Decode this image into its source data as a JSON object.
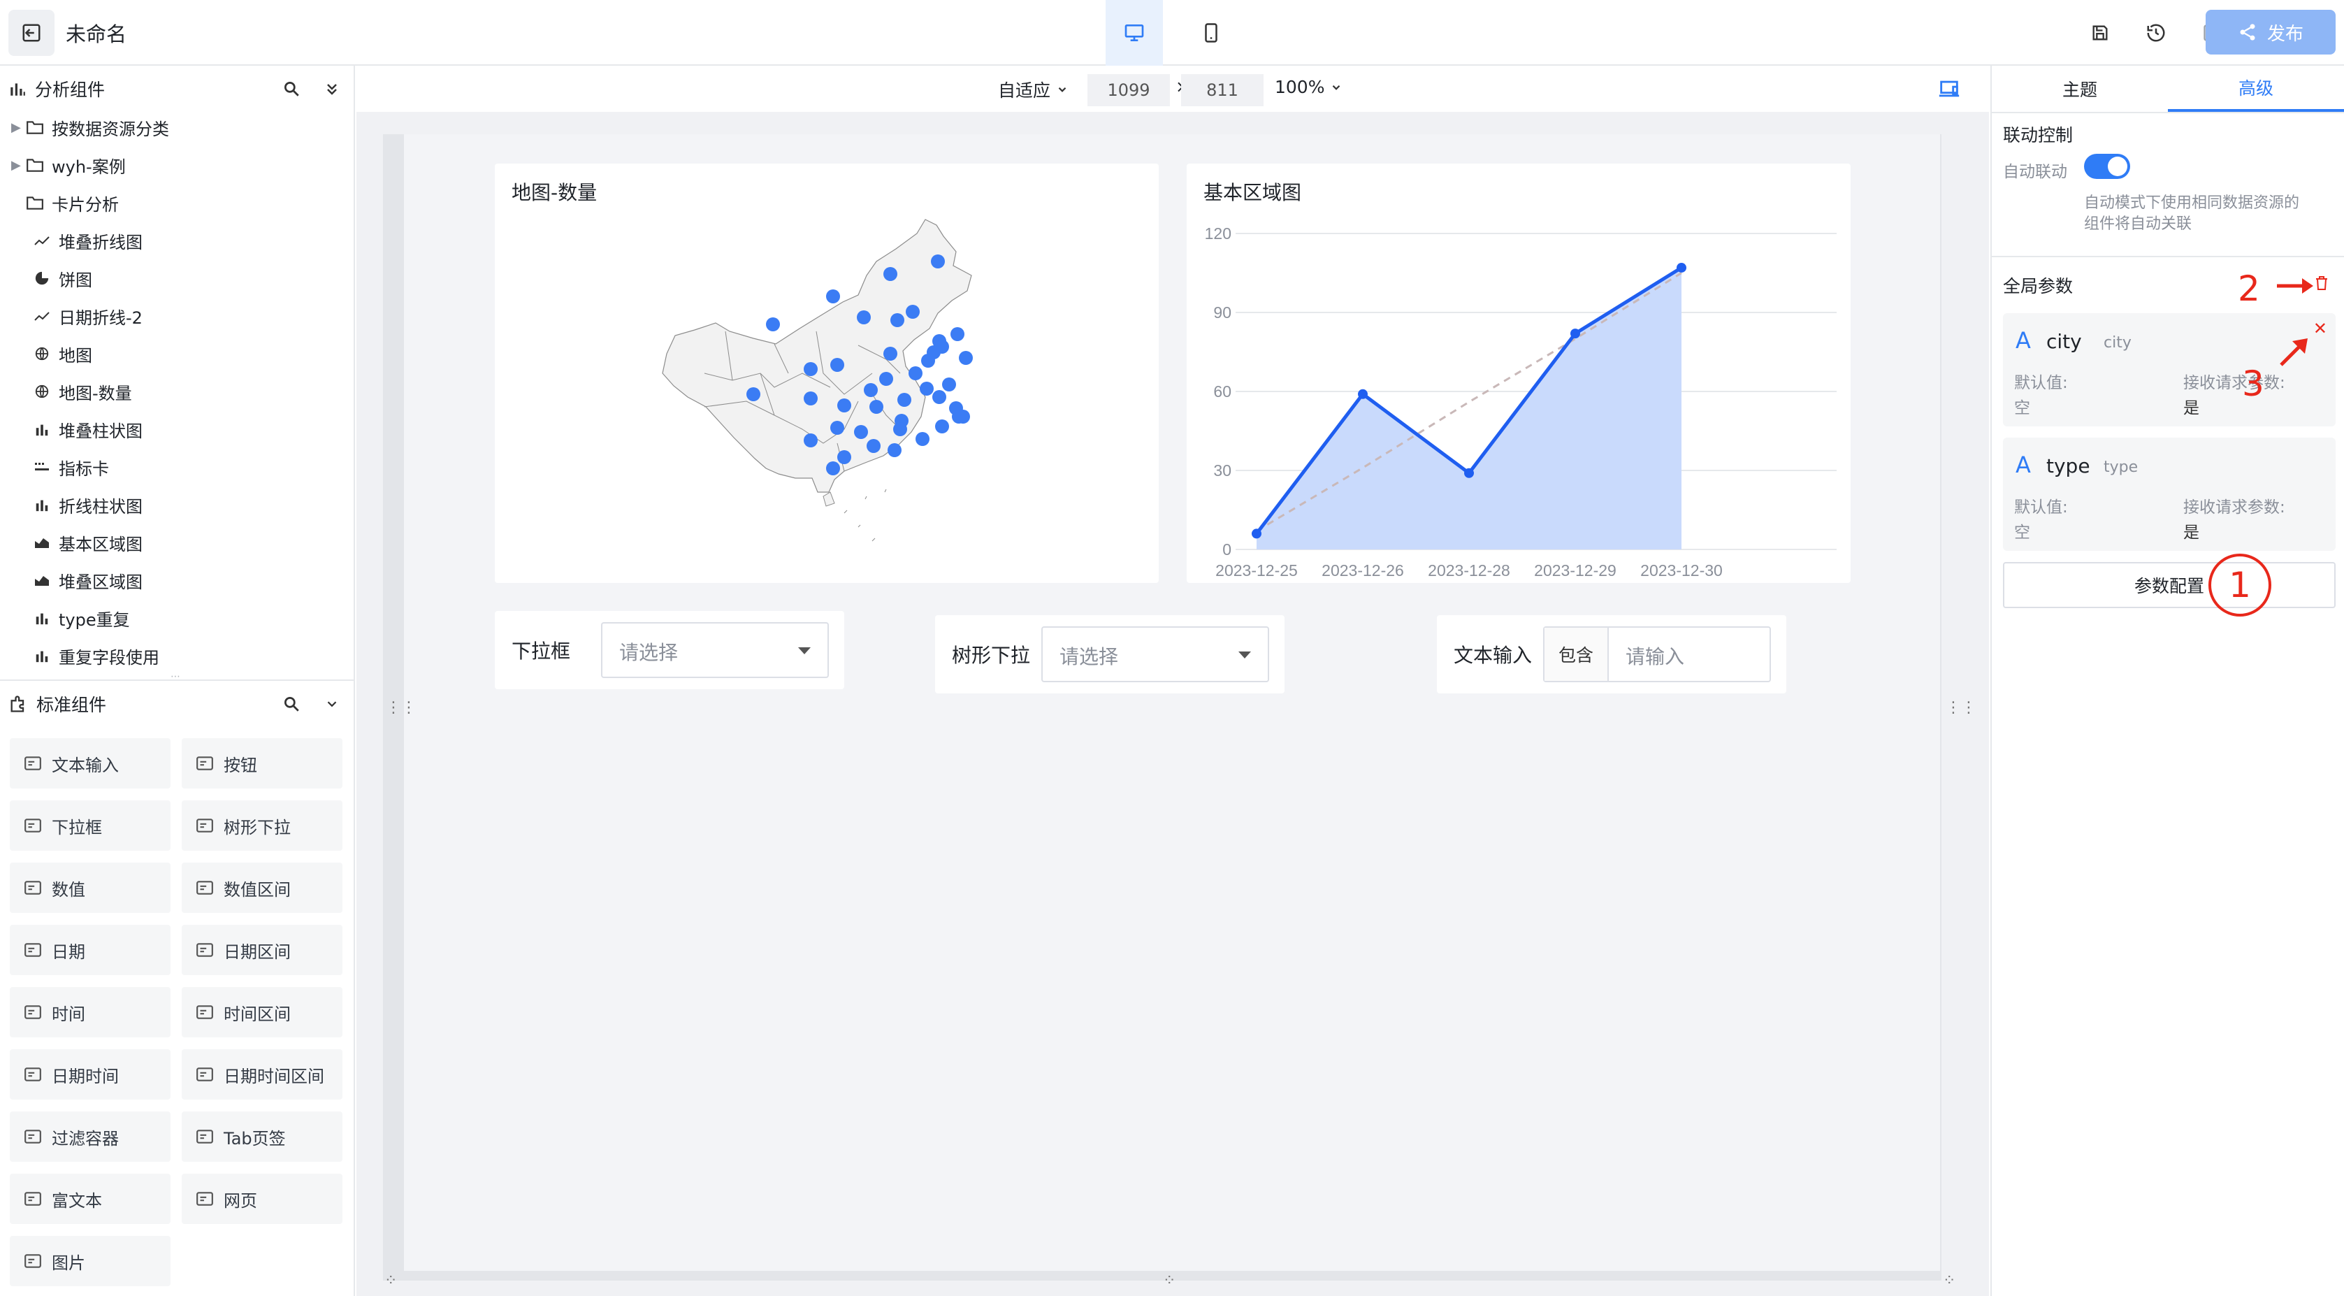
{
  "header": {
    "title": "未命名",
    "publish_label": "发布"
  },
  "left_panel": {
    "analysis_title": "分析组件",
    "tree": [
      {
        "label": "按数据资源分类",
        "type": "folder",
        "expandable": true
      },
      {
        "label": "wyh-案例",
        "type": "folder",
        "expandable": true
      },
      {
        "label": "卡片分析",
        "type": "folder",
        "expandable": false
      },
      {
        "label": "堆叠折线图",
        "type": "line-icon"
      },
      {
        "label": "饼图",
        "type": "pie-icon"
      },
      {
        "label": "日期折线-2",
        "type": "line-icon"
      },
      {
        "label": "地图",
        "type": "map-icon"
      },
      {
        "label": "地图-数量",
        "type": "map-icon"
      },
      {
        "label": "堆叠柱状图",
        "type": "bar-icon"
      },
      {
        "label": "指标卡",
        "type": "card-icon"
      },
      {
        "label": "折线柱状图",
        "type": "bar-icon"
      },
      {
        "label": "基本区域图",
        "type": "area-icon"
      },
      {
        "label": "堆叠区域图",
        "type": "area-icon"
      },
      {
        "label": "type重复",
        "type": "bar-icon"
      },
      {
        "label": "重复字段使用",
        "type": "bar-icon"
      }
    ],
    "standard_title": "标准组件",
    "components": [
      {
        "label": "文本输入",
        "icon": "text-input-icon"
      },
      {
        "label": "按钮",
        "icon": "button-icon"
      },
      {
        "label": "下拉框",
        "icon": "dropdown-icon"
      },
      {
        "label": "树形下拉",
        "icon": "tree-dropdown-icon"
      },
      {
        "label": "数值",
        "icon": "number-icon"
      },
      {
        "label": "数值区间",
        "icon": "number-range-icon"
      },
      {
        "label": "日期",
        "icon": "calendar-icon"
      },
      {
        "label": "日期区间",
        "icon": "calendar-range-icon"
      },
      {
        "label": "时间",
        "icon": "clock-icon"
      },
      {
        "label": "时间区间",
        "icon": "clock-range-icon"
      },
      {
        "label": "日期时间",
        "icon": "datetime-icon"
      },
      {
        "label": "日期时间区间",
        "icon": "datetime-range-icon"
      },
      {
        "label": "过滤容器",
        "icon": "filter-container-icon"
      },
      {
        "label": "Tab页签",
        "icon": "tab-icon"
      },
      {
        "label": "富文本",
        "icon": "rich-text-icon"
      },
      {
        "label": "网页",
        "icon": "webpage-icon"
      },
      {
        "label": "图片",
        "icon": "image-icon"
      }
    ]
  },
  "toolbar": {
    "fit_label": "自适应",
    "width_value": "1099",
    "times": "×",
    "height_value": "811",
    "zoom_label": "100%"
  },
  "canvas": {
    "map_title": "地图-数量",
    "area_title": "基本区域图",
    "dropdown_label": "下拉框",
    "dropdown_placeholder": "请选择",
    "tree_dropdown_label": "树形下拉",
    "tree_dropdown_placeholder": "请选择",
    "text_input_label": "文本输入",
    "text_input_mode": "包含",
    "text_input_placeholder": "请输入"
  },
  "chart_data": {
    "type": "area",
    "title": "基本区域图",
    "categories": [
      "2023-12-25",
      "2023-12-26",
      "2023-12-28",
      "2023-12-29",
      "2023-12-30"
    ],
    "series": [
      {
        "values": [
          6,
          59,
          29,
          82,
          107
        ],
        "color": "#1f5ef0",
        "fill": "#c9dafc"
      }
    ],
    "trendline": [
      7,
      31,
      56,
      80,
      105
    ],
    "yticks": [
      0,
      30,
      60,
      90,
      120
    ],
    "ylim": [
      0,
      120
    ],
    "grid": true
  },
  "right_panel": {
    "tabs": [
      "主题",
      "高级"
    ],
    "active_tab": "高级",
    "link_section_title": "联动控制",
    "auto_link_label": "自动联动",
    "auto_link_on": true,
    "auto_link_desc_1": "自动模式下使用相同数据资源的",
    "auto_link_desc_2": "组件将自动关联",
    "global_params_title": "全局参数",
    "params": [
      {
        "name": "city",
        "alias": "city",
        "default_label": "默认值:",
        "default_value": "空",
        "receive_label": "接收请求参数:",
        "receive_value": "是"
      },
      {
        "name": "type",
        "alias": "type",
        "default_label": "默认值:",
        "default_value": "空",
        "receive_label": "接收请求参数:",
        "receive_value": "是"
      }
    ],
    "param_config_label": "参数配置",
    "accent_color": "#2f7cf6"
  },
  "annotations": {
    "one": "1",
    "two": "2",
    "three": "3"
  }
}
